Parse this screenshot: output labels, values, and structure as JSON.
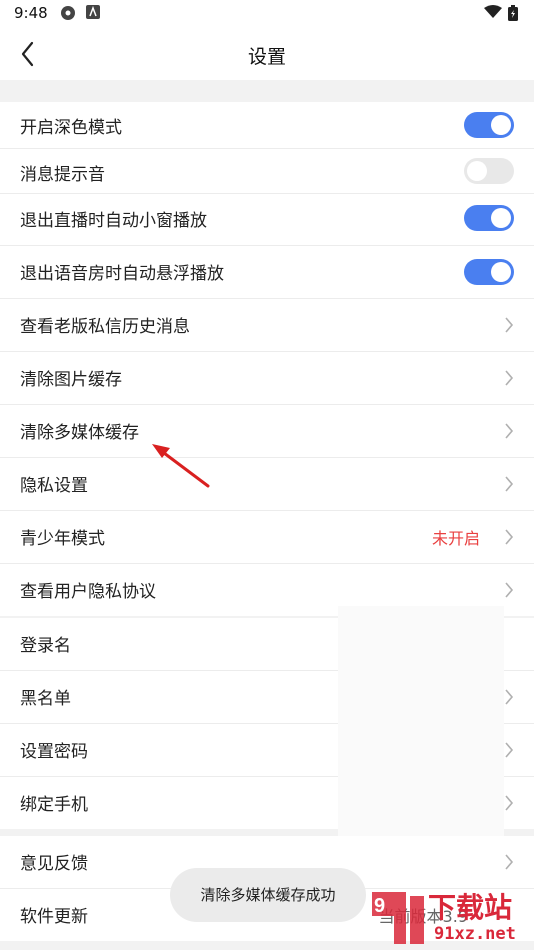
{
  "status_bar": {
    "time": "9:48"
  },
  "header": {
    "title": "设置"
  },
  "section1": [
    {
      "label": "开启深色模式",
      "toggle": "on"
    },
    {
      "label": "消息提示音",
      "toggle": "off"
    },
    {
      "label": "退出直播时自动小窗播放",
      "toggle": "on"
    },
    {
      "label": "退出语音房时自动悬浮播放",
      "toggle": "on"
    },
    {
      "label": "查看老版私信历史消息"
    },
    {
      "label": "清除图片缓存"
    },
    {
      "label": "清除多媒体缓存"
    },
    {
      "label": "隐私设置"
    },
    {
      "label": "青少年模式",
      "value": "未开启"
    },
    {
      "label": "查看用户隐私协议"
    }
  ],
  "section2": [
    {
      "label": "登录名"
    },
    {
      "label": "黑名单"
    },
    {
      "label": "设置密码"
    },
    {
      "label": "绑定手机"
    }
  ],
  "section3": [
    {
      "label": "意见反馈"
    },
    {
      "label": "软件更新",
      "value": "当前版本3.9"
    }
  ],
  "toast": "清除多媒体缓存成功",
  "watermark": {
    "text": "下载站",
    "sub": "91xz.net"
  },
  "colors": {
    "accent": "#4a7ff0",
    "warn": "#e94040",
    "watermark": "#d9283a"
  }
}
